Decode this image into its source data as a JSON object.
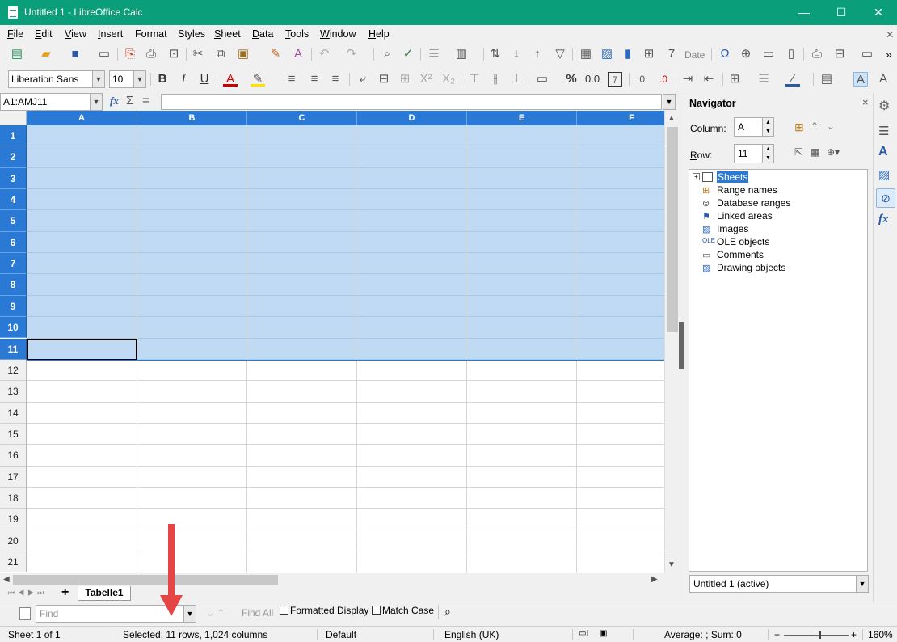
{
  "window": {
    "title": "Untitled 1 - LibreOffice Calc",
    "min": "—",
    "max": "☐",
    "close": "✕"
  },
  "menu": {
    "items": [
      {
        "label": "File",
        "u": "F",
        "rest": "ile"
      },
      {
        "label": "Edit",
        "u": "E",
        "rest": "dit"
      },
      {
        "label": "View",
        "u": "V",
        "rest": "iew"
      },
      {
        "label": "Insert",
        "u": "I",
        "rest": "nsert"
      },
      {
        "label": "Format",
        "u": "",
        "rest": "Format"
      },
      {
        "label": "Styles",
        "u": "",
        "rest": "Styles"
      },
      {
        "label": "Sheet",
        "u": "S",
        "rest": "heet"
      },
      {
        "label": "Data",
        "u": "D",
        "rest": "ata"
      },
      {
        "label": "Tools",
        "u": "T",
        "rest": "ools"
      },
      {
        "label": "Window",
        "u": "W",
        "rest": "indow"
      },
      {
        "label": "Help",
        "u": "H",
        "rest": "elp"
      }
    ],
    "overflow": "✕"
  },
  "toolbar": {
    "date_label": "Date",
    "more": "»"
  },
  "format_toolbar": {
    "font_name": "Liberation Sans",
    "font_size": "10",
    "bold": "B",
    "italic": "I",
    "underline": "U",
    "percent": "%",
    "number": "0.0",
    "decimal_add": ".0",
    "decimal_del": ".0"
  },
  "formula_bar": {
    "name_box": "A1:AMJ11",
    "fx": "fx",
    "sum": "Σ",
    "equals": "="
  },
  "grid": {
    "columns": [
      "A",
      "B",
      "C",
      "D",
      "E",
      "F"
    ],
    "rows": [
      "1",
      "2",
      "3",
      "4",
      "5",
      "6",
      "7",
      "8",
      "9",
      "10",
      "11",
      "12",
      "13",
      "14",
      "15",
      "16",
      "17",
      "18",
      "19",
      "20",
      "21"
    ],
    "selected_rows": 11,
    "selection_color": "#bfdaf2",
    "header_selected_color": "#2a7ad5"
  },
  "sheet_tabs": {
    "add": "+",
    "active_tab": "Tabelle1"
  },
  "findbar": {
    "placeholder": "Find",
    "find_all": "Find All",
    "formatted_display": "Formatted Display",
    "match_case": "Match Case"
  },
  "statusbar": {
    "sheet": "Sheet 1 of 1",
    "selection": "Selected: 11 rows, 1,024 columns",
    "style": "Default",
    "language": "English (UK)",
    "summary": "Average: ; Sum: 0",
    "zoom": "160%",
    "zoom_minus": "−",
    "zoom_plus": "+"
  },
  "navigator": {
    "title": "Navigator",
    "close": "×",
    "column_label": "Column:",
    "column_u": "C",
    "column_rest": "olumn:",
    "column_value": "A",
    "row_label": "Row:",
    "row_u": "R",
    "row_rest": "ow:",
    "row_value": "11",
    "tree": [
      "Sheets",
      "Range names",
      "Database ranges",
      "Linked areas",
      "Images",
      "OLE objects",
      "Comments",
      "Drawing objects"
    ],
    "document": "Untitled 1 (active)"
  },
  "sidebar_icons": [
    "gear-icon",
    "properties-icon",
    "styles-icon",
    "gallery-icon",
    "navigator-icon",
    "functions-icon"
  ],
  "annotation": {
    "arrow_color": "#e54545"
  }
}
